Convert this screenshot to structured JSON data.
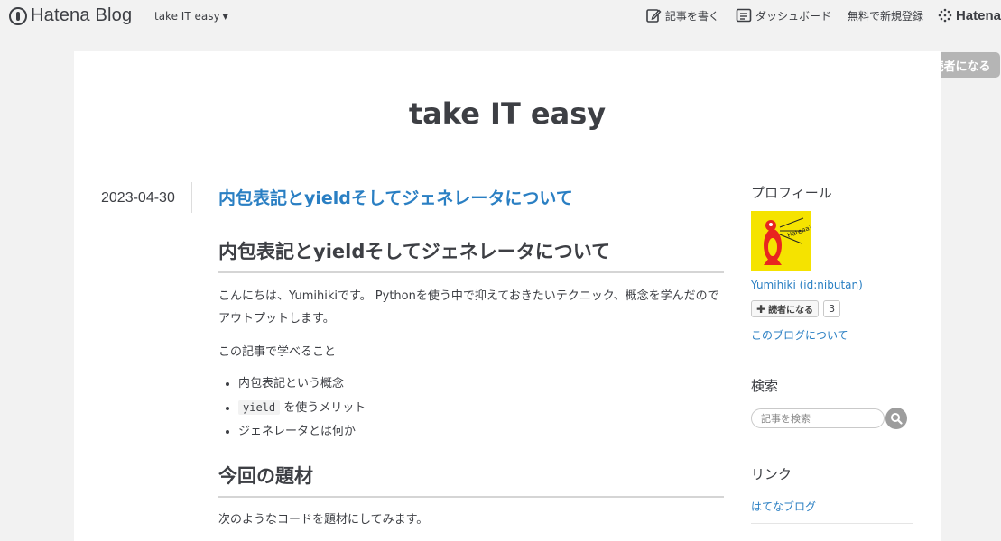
{
  "topbar": {
    "brand": "Hatena Blog",
    "blog_switch": "take IT easy",
    "nav": {
      "write": "記事を書く",
      "dashboard": "ダッシュボード",
      "signup": "無料で新規登録",
      "hatena": "Hatena"
    }
  },
  "subscribe_float": "読者になる",
  "blog": {
    "title": "take IT easy"
  },
  "entry": {
    "date": "2023-04-30",
    "title": "内包表記とyieldそしてジェネレータについて",
    "heading1": "内包表記とyieldそしてジェネレータについて",
    "intro": "こんにちは、Yumihikiです。 Pythonを使う中で抑えておきたいテクニック、概念を学んだのでアウトプットします。",
    "learn_label": "この記事で学べること",
    "list": {
      "item1": "内包表記という概念",
      "item2_code": "yield",
      "item2_text": "を使うメリット",
      "item3": "ジェネレータとは何か"
    },
    "heading2": "今回の題材",
    "next": "次のようなコードを題材にしてみます。"
  },
  "sidebar": {
    "profile": {
      "title": "プロフィール",
      "name": "Yumihiki (id:nibutan)",
      "subscribe_label": "読者になる",
      "subscriber_count": "3",
      "about": "このブログについて"
    },
    "search": {
      "title": "検索",
      "placeholder": "記事を検索"
    },
    "links": {
      "title": "リンク",
      "items": [
        "はてなブログ"
      ]
    }
  },
  "colors": {
    "link": "#2a7fc3",
    "text": "#3d3f44",
    "background": "#f2f2f2",
    "profile_yellow": "#f5e300"
  }
}
